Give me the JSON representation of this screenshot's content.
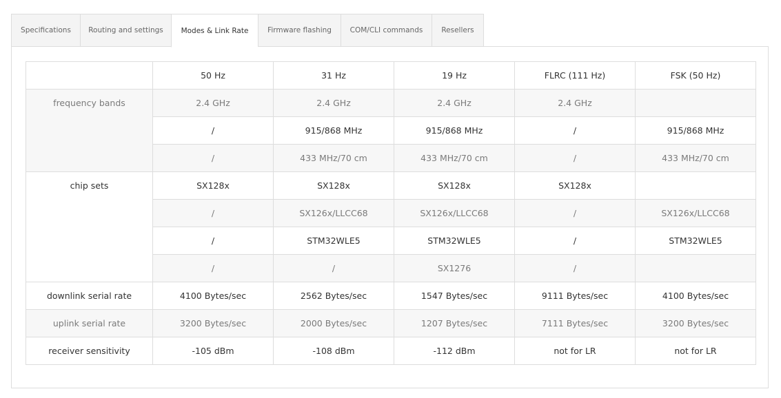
{
  "tabs": [
    {
      "label": "Specifications",
      "active": false
    },
    {
      "label": "Routing and settings",
      "active": false
    },
    {
      "label": "Modes & Link Rate",
      "active": true
    },
    {
      "label": "Firmware flashing",
      "active": false
    },
    {
      "label": "COM/CLI commands",
      "active": false
    },
    {
      "label": "Resellers",
      "active": false
    }
  ],
  "table": {
    "columns": [
      "",
      "50 Hz",
      "31 Hz",
      "19 Hz",
      "FLRC (111 Hz)",
      "FSK (50 Hz)"
    ],
    "groups": [
      {
        "label": "frequency bands",
        "rows": [
          [
            "2.4 GHz",
            "2.4 GHz",
            "2.4 GHz",
            "2.4 GHz",
            ""
          ],
          [
            "/",
            "915/868 MHz",
            "915/868 MHz",
            "/",
            "915/868 MHz"
          ],
          [
            "/",
            "433 MHz/70 cm",
            "433 MHz/70 cm",
            "/",
            "433 MHz/70 cm"
          ]
        ]
      },
      {
        "label": "chip sets",
        "rows": [
          [
            "SX128x",
            "SX128x",
            "SX128x",
            "SX128x",
            ""
          ],
          [
            "/",
            "SX126x/LLCC68",
            "SX126x/LLCC68",
            "/",
            "SX126x/LLCC68"
          ],
          [
            "/",
            "STM32WLE5",
            "STM32WLE5",
            "/",
            "STM32WLE5"
          ],
          [
            "/",
            "/",
            "SX1276",
            "/",
            ""
          ]
        ]
      },
      {
        "label": "downlink serial rate",
        "rows": [
          [
            "4100 Bytes/sec",
            "2562 Bytes/sec",
            "1547 Bytes/sec",
            "9111 Bytes/sec",
            "4100 Bytes/sec"
          ]
        ]
      },
      {
        "label": "uplink serial rate",
        "rows": [
          [
            "3200 Bytes/sec",
            "2000 Bytes/sec",
            "1207 Bytes/sec",
            "7111 Bytes/sec",
            "3200 Bytes/sec"
          ]
        ]
      },
      {
        "label": "receiver sensitivity",
        "rows": [
          [
            "-105 dBm",
            "-108 dBm",
            "-112 dBm",
            "not for LR",
            "not for LR"
          ]
        ]
      }
    ]
  }
}
